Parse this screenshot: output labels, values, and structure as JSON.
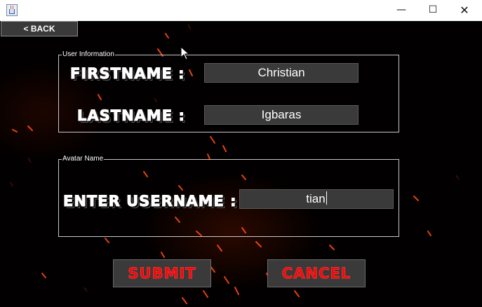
{
  "window": {
    "title": "",
    "icon": "java-cup-icon",
    "controls": {
      "minimize": "—",
      "maximize": "☐",
      "close": "✕"
    }
  },
  "nav": {
    "back_label": "< BACK"
  },
  "user_information": {
    "legend": "User Information",
    "firstname_label": "FIRSTNAME :",
    "firstname_value": "Christian",
    "lastname_label": "LASTNAME :",
    "lastname_value": "Igbaras"
  },
  "avatar": {
    "legend": "Avatar Name",
    "username_label": "ENTER USERNAME :",
    "username_value": "tian"
  },
  "actions": {
    "submit_label": "SUBMIT",
    "cancel_label": "CANCEL"
  },
  "colors": {
    "background": "#020000",
    "field_bg": "#3a3a3a",
    "button_text": "#e01010",
    "label_text": "#ffffff",
    "spark": "#ff4a10"
  }
}
